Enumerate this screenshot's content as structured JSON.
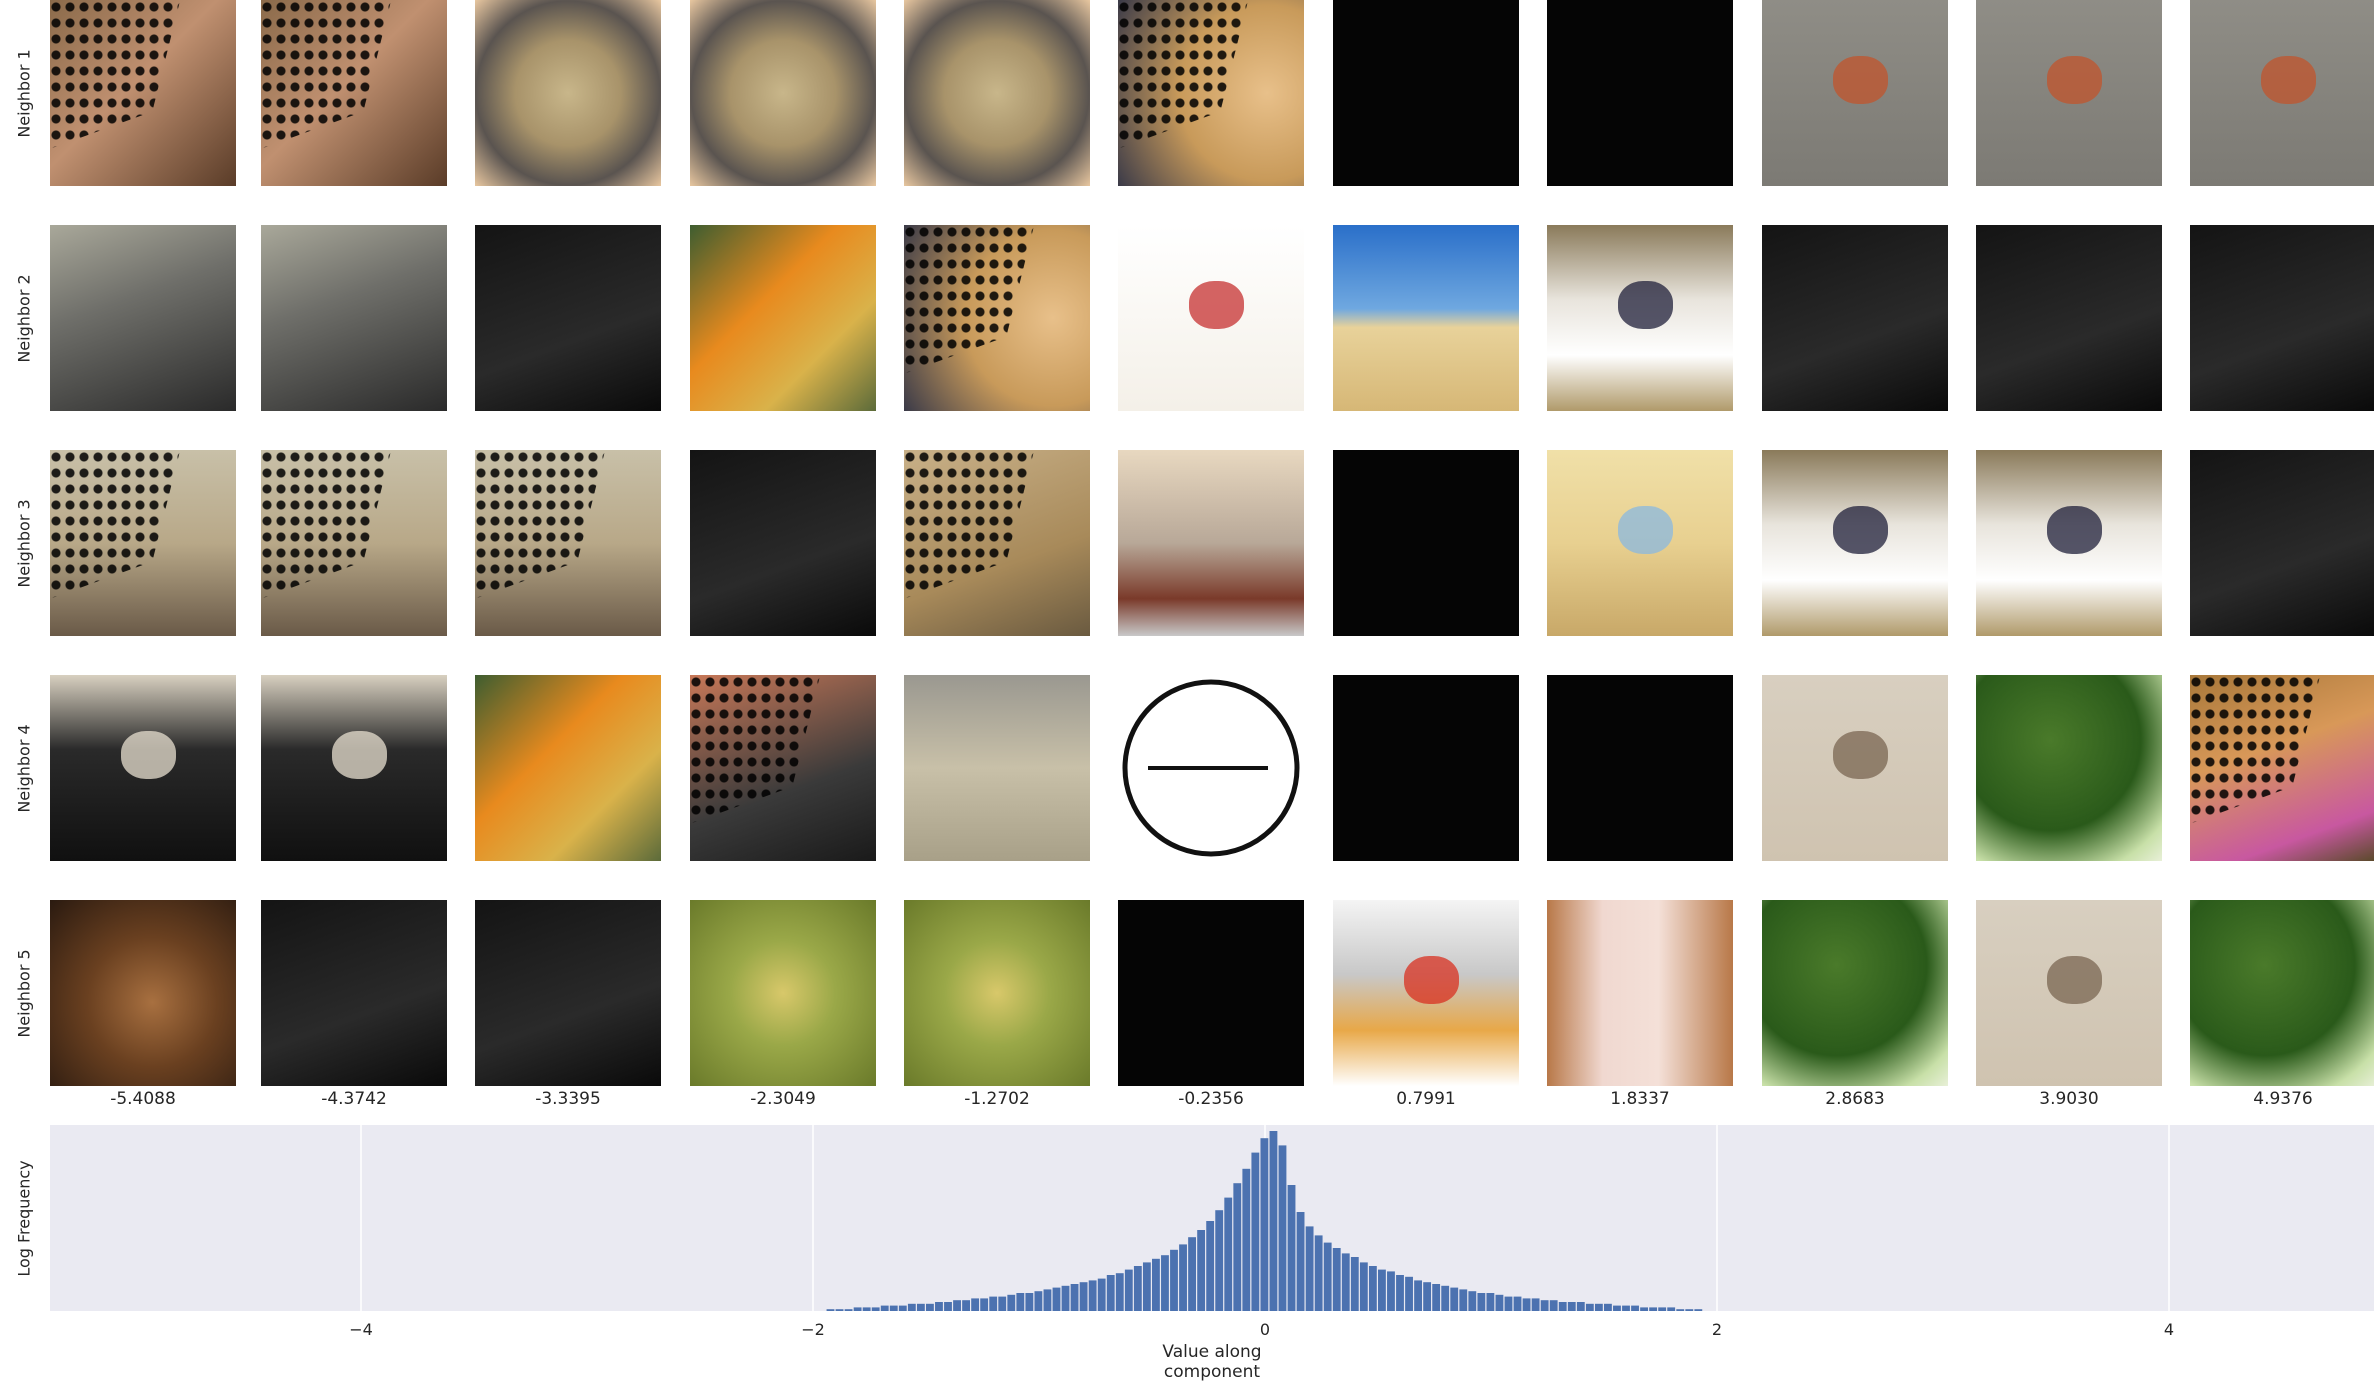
{
  "figure": {
    "row_labels": [
      "Neighbor 1",
      "Neighbor 2",
      "Neighbor 3",
      "Neighbor 4",
      "Neighbor 5"
    ],
    "column_values": [
      "-5.4088",
      "-4.3742",
      "-3.3395",
      "-2.3049",
      "-1.2702",
      "-0.2356",
      "0.7991",
      "1.8337",
      "2.8683",
      "3.9030",
      "4.9376"
    ],
    "tiles": [
      [
        "dog-fur-masked",
        "dog-fur-masked",
        "belt-buckle",
        "belt-buckle",
        "belt-buckle",
        "wall-clock-masked",
        "dark",
        "dark",
        "merganser-duck",
        "merganser-duck",
        "merganser-duck"
      ],
      [
        "sleeping-puppies",
        "sleeping-puppies",
        "dark-masked",
        "butternut-squash",
        "wall-clock-masked",
        "toy-abacus",
        "beach-fence",
        "terrier-dog",
        "dark-masked",
        "dark-masked",
        "dark-masked"
      ],
      [
        "seal-masked",
        "seal-masked",
        "seal-masked",
        "dark-masked",
        "bicycle-masked",
        "shelf-bottles",
        "dark",
        "baby-crib",
        "terrier-dog",
        "terrier-dog",
        "dark-masked"
      ],
      [
        "typewriter",
        "typewriter",
        "butternut-squash",
        "barbell-masked",
        "canvas-bag",
        "stopwatch-dial",
        "dark",
        "dark",
        "camel",
        "broccoli",
        "cat-flowers-masked"
      ],
      [
        "german-shepherd",
        "dark-masked",
        "dark-masked",
        "artichoke",
        "artichoke",
        "dark",
        "waffle-maker",
        "soap-dispenser",
        "broccoli",
        "camel",
        "broccoli"
      ]
    ],
    "colors": {
      "panel": "#eaeaf2",
      "bars": "#4c72b0",
      "grid": "#ffffff"
    }
  },
  "chart_data": {
    "type": "bar",
    "title": "",
    "xlabel": "Value along component",
    "ylabel": "Log Frequency",
    "xlim": [
      -6.88,
      4.94
    ],
    "xticks": [
      -4,
      -2,
      0,
      2,
      4
    ],
    "xtick_labels": [
      "−4",
      "−2",
      "0",
      "2",
      "4"
    ],
    "grid": true,
    "y_scale": "log",
    "series": [
      {
        "values": [
          {
            "x": -1.92,
            "y": 0.01
          },
          {
            "x": -1.88,
            "y": 0.01
          },
          {
            "x": -1.84,
            "y": 0.01
          },
          {
            "x": -1.8,
            "y": 0.02
          },
          {
            "x": -1.76,
            "y": 0.02
          },
          {
            "x": -1.72,
            "y": 0.02
          },
          {
            "x": -1.68,
            "y": 0.03
          },
          {
            "x": -1.64,
            "y": 0.03
          },
          {
            "x": -1.6,
            "y": 0.03
          },
          {
            "x": -1.56,
            "y": 0.04
          },
          {
            "x": -1.52,
            "y": 0.04
          },
          {
            "x": -1.48,
            "y": 0.04
          },
          {
            "x": -1.44,
            "y": 0.05
          },
          {
            "x": -1.4,
            "y": 0.05
          },
          {
            "x": -1.36,
            "y": 0.06
          },
          {
            "x": -1.32,
            "y": 0.06
          },
          {
            "x": -1.28,
            "y": 0.07
          },
          {
            "x": -1.24,
            "y": 0.07
          },
          {
            "x": -1.2,
            "y": 0.08
          },
          {
            "x": -1.16,
            "y": 0.08
          },
          {
            "x": -1.12,
            "y": 0.09
          },
          {
            "x": -1.08,
            "y": 0.1
          },
          {
            "x": -1.04,
            "y": 0.1
          },
          {
            "x": -1.0,
            "y": 0.11
          },
          {
            "x": -0.96,
            "y": 0.12
          },
          {
            "x": -0.92,
            "y": 0.13
          },
          {
            "x": -0.88,
            "y": 0.14
          },
          {
            "x": -0.84,
            "y": 0.15
          },
          {
            "x": -0.8,
            "y": 0.16
          },
          {
            "x": -0.76,
            "y": 0.17
          },
          {
            "x": -0.72,
            "y": 0.18
          },
          {
            "x": -0.68,
            "y": 0.2
          },
          {
            "x": -0.64,
            "y": 0.21
          },
          {
            "x": -0.6,
            "y": 0.23
          },
          {
            "x": -0.56,
            "y": 0.25
          },
          {
            "x": -0.52,
            "y": 0.27
          },
          {
            "x": -0.48,
            "y": 0.29
          },
          {
            "x": -0.44,
            "y": 0.31
          },
          {
            "x": -0.4,
            "y": 0.34
          },
          {
            "x": -0.36,
            "y": 0.37
          },
          {
            "x": -0.32,
            "y": 0.41
          },
          {
            "x": -0.28,
            "y": 0.45
          },
          {
            "x": -0.24,
            "y": 0.5
          },
          {
            "x": -0.2,
            "y": 0.56
          },
          {
            "x": -0.16,
            "y": 0.63
          },
          {
            "x": -0.12,
            "y": 0.71
          },
          {
            "x": -0.08,
            "y": 0.79
          },
          {
            "x": -0.04,
            "y": 0.88
          },
          {
            "x": 0.0,
            "y": 0.96
          },
          {
            "x": 0.04,
            "y": 1.0
          },
          {
            "x": 0.08,
            "y": 0.92
          },
          {
            "x": 0.12,
            "y": 0.7
          },
          {
            "x": 0.16,
            "y": 0.55
          },
          {
            "x": 0.2,
            "y": 0.47
          },
          {
            "x": 0.24,
            "y": 0.42
          },
          {
            "x": 0.28,
            "y": 0.38
          },
          {
            "x": 0.32,
            "y": 0.35
          },
          {
            "x": 0.36,
            "y": 0.32
          },
          {
            "x": 0.4,
            "y": 0.3
          },
          {
            "x": 0.44,
            "y": 0.27
          },
          {
            "x": 0.48,
            "y": 0.25
          },
          {
            "x": 0.52,
            "y": 0.23
          },
          {
            "x": 0.56,
            "y": 0.22
          },
          {
            "x": 0.6,
            "y": 0.2
          },
          {
            "x": 0.64,
            "y": 0.19
          },
          {
            "x": 0.68,
            "y": 0.17
          },
          {
            "x": 0.72,
            "y": 0.16
          },
          {
            "x": 0.76,
            "y": 0.15
          },
          {
            "x": 0.8,
            "y": 0.14
          },
          {
            "x": 0.84,
            "y": 0.13
          },
          {
            "x": 0.88,
            "y": 0.12
          },
          {
            "x": 0.92,
            "y": 0.11
          },
          {
            "x": 0.96,
            "y": 0.1
          },
          {
            "x": 1.0,
            "y": 0.1
          },
          {
            "x": 1.04,
            "y": 0.09
          },
          {
            "x": 1.08,
            "y": 0.08
          },
          {
            "x": 1.12,
            "y": 0.08
          },
          {
            "x": 1.16,
            "y": 0.07
          },
          {
            "x": 1.2,
            "y": 0.07
          },
          {
            "x": 1.24,
            "y": 0.06
          },
          {
            "x": 1.28,
            "y": 0.06
          },
          {
            "x": 1.32,
            "y": 0.05
          },
          {
            "x": 1.36,
            "y": 0.05
          },
          {
            "x": 1.4,
            "y": 0.05
          },
          {
            "x": 1.44,
            "y": 0.04
          },
          {
            "x": 1.48,
            "y": 0.04
          },
          {
            "x": 1.52,
            "y": 0.04
          },
          {
            "x": 1.56,
            "y": 0.03
          },
          {
            "x": 1.6,
            "y": 0.03
          },
          {
            "x": 1.64,
            "y": 0.03
          },
          {
            "x": 1.68,
            "y": 0.02
          },
          {
            "x": 1.72,
            "y": 0.02
          },
          {
            "x": 1.76,
            "y": 0.02
          },
          {
            "x": 1.8,
            "y": 0.02
          },
          {
            "x": 1.84,
            "y": 0.01
          },
          {
            "x": 1.88,
            "y": 0.01
          },
          {
            "x": 1.92,
            "y": 0.01
          }
        ]
      }
    ]
  }
}
